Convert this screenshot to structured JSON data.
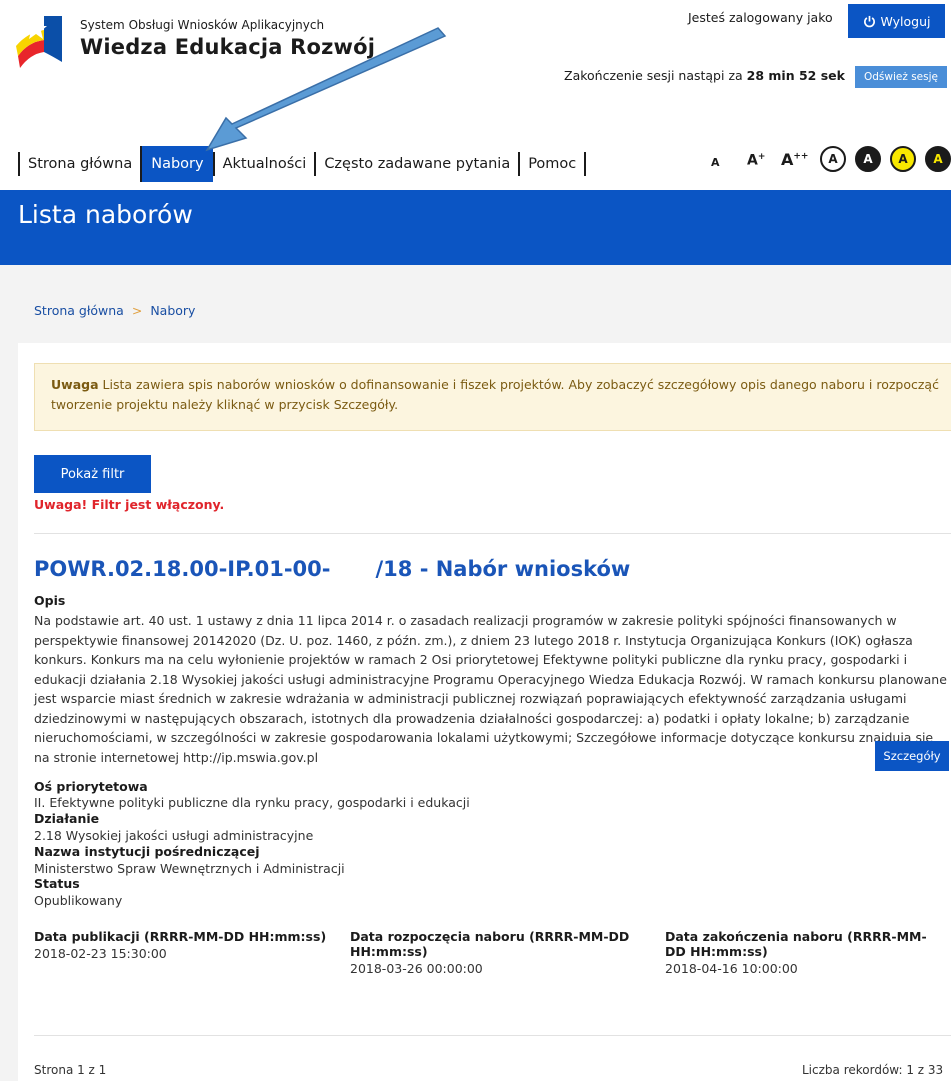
{
  "header": {
    "system_small": "System Obsługi Wniosków Aplikacyjnych",
    "system_big": "Wiedza Edukacja Rozwój",
    "logged_in_text": "Jesteś zalogowany jako",
    "logout_label": "Wyloguj",
    "session_text": "Zakończenie sesji nastąpi za ",
    "session_time": "28 min 52 sek",
    "refresh_label": "Odśwież sesję"
  },
  "nav": {
    "items": [
      {
        "label": "Strona główna"
      },
      {
        "label": "Nabory"
      },
      {
        "label": "Aktualności"
      },
      {
        "label": "Często zadawane pytania"
      },
      {
        "label": "Pomoc"
      }
    ],
    "active": "Nabory"
  },
  "accessibility": {
    "font_small": "A",
    "font_medium": "A",
    "font_medium_sup": "+",
    "font_large": "A",
    "font_large_sup": "++",
    "contrast_labels": [
      "A",
      "A",
      "A",
      "A"
    ]
  },
  "page": {
    "title": "Lista naborów",
    "breadcrumb": [
      "Strona główna",
      "Nabory"
    ],
    "breadcrumb_sep": ">"
  },
  "notice": {
    "strong": "Uwaga",
    "text": " Lista zawiera spis naborów wniosków o dofinansowanie i fiszek projektów. Aby zobaczyć szczegółowy opis danego naboru i rozpocząć tworzenie projektu należy kliknąć w przycisk Szczegóły."
  },
  "filter": {
    "button_label": "Pokaż filtr",
    "warning": "Uwaga! Filtr jest włączony."
  },
  "nabor": {
    "title_part1": "POWR.02.18.00-IP.01-00-",
    "title_part2": "/18 - Nabór wniosków",
    "opis_label": "Opis",
    "opis_text": "Na podstawie art. 40 ust. 1 ustawy z dnia 11 lipca 2014 r. o zasadach realizacji programów w zakresie polityki spójności finansowanych w perspektywie finansowej 20142020 (Dz. U. poz. 1460, z późn. zm.), z dniem 23 lutego 2018 r. Instytucja Organizująca Konkurs (IOK) ogłasza konkurs. Konkurs ma na celu wyłonienie projektów w ramach 2 Osi priorytetowej Efektywne polityki publiczne dla rynku pracy, gospodarki i edukacji działania 2.18 Wysokiej jakości usługi administracyjne Programu Operacyjnego Wiedza Edukacja Rozwój. W ramach konkursu planowane jest wsparcie miast średnich w zakresie wdrażania w administracji publicznej rozwiązań poprawiających efektywność zarządzania usługami dziedzinowymi w następujących obszarach, istotnych dla prowadzenia działalności gospodarczej: a) podatki i opłaty lokalne; b) zarządzanie nieruchomościami, w szczególności w zakresie gospodarowania lokalami użytkowymi; Szczegółowe informacje dotyczące konkursu znajdują się na stronie internetowej http://ip.mswia.gov.pl",
    "os_label": "Oś priorytetowa",
    "os_value": "II. Efektywne polityki publiczne dla rynku pracy, gospodarki i edukacji",
    "dzialanie_label": "Działanie",
    "dzialanie_value": "2.18 Wysokiej jakości usługi administracyjne",
    "instytucja_label": "Nazwa instytucji pośredniczącej",
    "instytucja_value": "Ministerstwo Spraw Wewnętrznych i Administracji",
    "status_label": "Status",
    "status_value": "Opublikowany",
    "pub_label": "Data publikacji (RRRR-MM-DD HH:mm:ss)",
    "pub_value": "2018-02-23 15:30:00",
    "start_label": "Data rozpoczęcia naboru (RRRR-MM-DD HH:mm:ss)",
    "start_value": "2018-03-26 00:00:00",
    "end_label": "Data zakończenia naboru (RRRR-MM-DD HH:mm:ss)",
    "end_value": "2018-04-16 10:00:00",
    "details_label": "Szczegóły"
  },
  "footer": {
    "page_info": "Strona 1 z 1",
    "records": "Liczba rekordów: 1 z 33"
  },
  "colors": {
    "primary": "#0b55c4",
    "link": "#1a55b8",
    "warning": "#e0242b",
    "notice_bg": "#fcf5df",
    "arrow": "#5b9bd5"
  },
  "icons": [
    "power-icon",
    "project-logo",
    "annotation-arrow"
  ]
}
